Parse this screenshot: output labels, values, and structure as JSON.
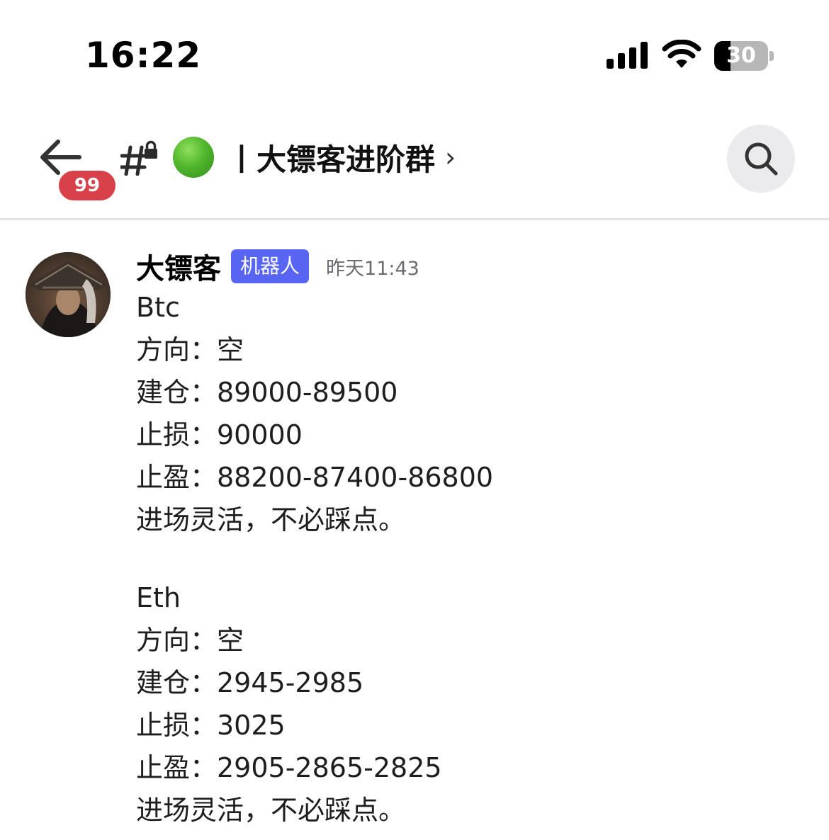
{
  "status_bar": {
    "time": "16:22",
    "battery_level": "30",
    "battery_fraction": 0.3
  },
  "header": {
    "back_badge": "99",
    "channel_name": "丨大镖客进阶群",
    "chevron": "›",
    "channel_icon": "locked-hash-icon",
    "status_color": "#52b72e"
  },
  "message": {
    "author": "大镖客",
    "bot_tag": "机器人",
    "timestamp": "昨天11:43",
    "tag_color": "#5865f2",
    "lines": [
      "Btc",
      "方向：空",
      "建仓：89000-89500",
      "止损：90000",
      "止盈：88200-87400-86800",
      "进场灵活，不必踩点。",
      "",
      "Eth",
      "方向：空",
      "建仓：2945-2985",
      "止损：3025",
      "止盈：2905-2865-2825",
      "进场灵活，不必踩点。"
    ]
  }
}
